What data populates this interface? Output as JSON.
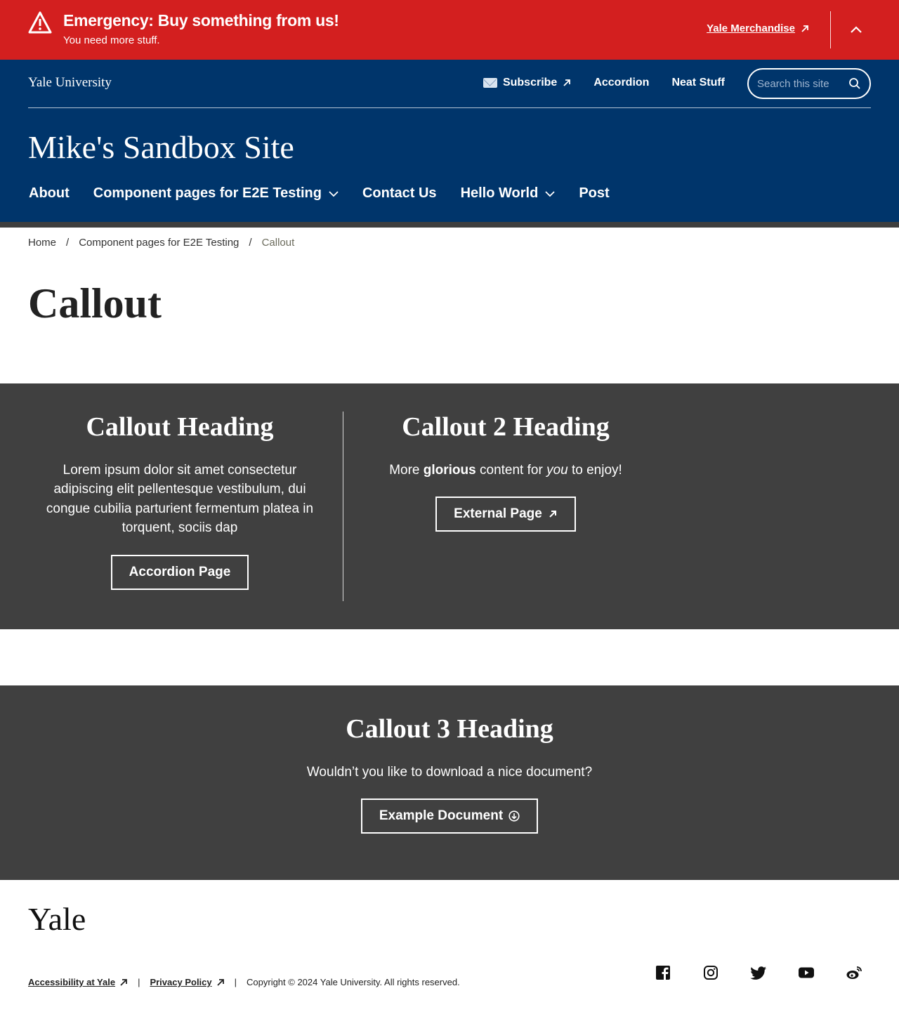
{
  "alert": {
    "title": "Emergency: Buy something from us!",
    "subtitle": "You need more stuff.",
    "link_label": "Yale Merchandise",
    "color": "#d31f1f"
  },
  "header": {
    "wordmark": "Yale University",
    "utility_nav": [
      {
        "label": "Subscribe",
        "icon": "envelope-icon",
        "external": true
      },
      {
        "label": "Accordion"
      },
      {
        "label": "Neat Stuff"
      }
    ],
    "search_placeholder": "Search this site",
    "site_title": "Mike's Sandbox Site",
    "main_nav": [
      {
        "label": "About",
        "dropdown": false
      },
      {
        "label": "Component pages for E2E Testing",
        "dropdown": true
      },
      {
        "label": "Contact Us",
        "dropdown": false
      },
      {
        "label": "Hello World",
        "dropdown": true
      },
      {
        "label": "Post",
        "dropdown": false
      }
    ],
    "color": "#00356b"
  },
  "breadcrumb": {
    "items": [
      "Home",
      "Component pages for E2E Testing",
      "Callout"
    ],
    "separator": "/"
  },
  "page": {
    "title": "Callout"
  },
  "callouts": [
    {
      "heading": "Callout Heading",
      "body": "Lorem ipsum dolor sit amet consectetur adipiscing elit pellentesque vestibulum, dui congue cubilia parturient fermentum platea in torquent, sociis dap",
      "button": "Accordion Page"
    },
    {
      "heading": "Callout 2 Heading",
      "body_parts": [
        "More ",
        "glorious",
        " content for ",
        "you",
        " to enjoy!"
      ],
      "button": "External Page",
      "button_icon": "external-link-icon"
    },
    {
      "heading": "Callout 3 Heading",
      "body": "Wouldn’t you like to download a nice document?",
      "button": "Example Document",
      "button_icon": "download-icon"
    }
  ],
  "footer": {
    "logo": "Yale",
    "links": [
      "Accessibility at Yale",
      "Privacy Policy"
    ],
    "separator": "|",
    "copyright": "Copyright © 2024 Yale University. All rights reserved.",
    "social": [
      "facebook-icon",
      "instagram-icon",
      "twitter-icon",
      "youtube-icon",
      "weibo-icon"
    ]
  }
}
